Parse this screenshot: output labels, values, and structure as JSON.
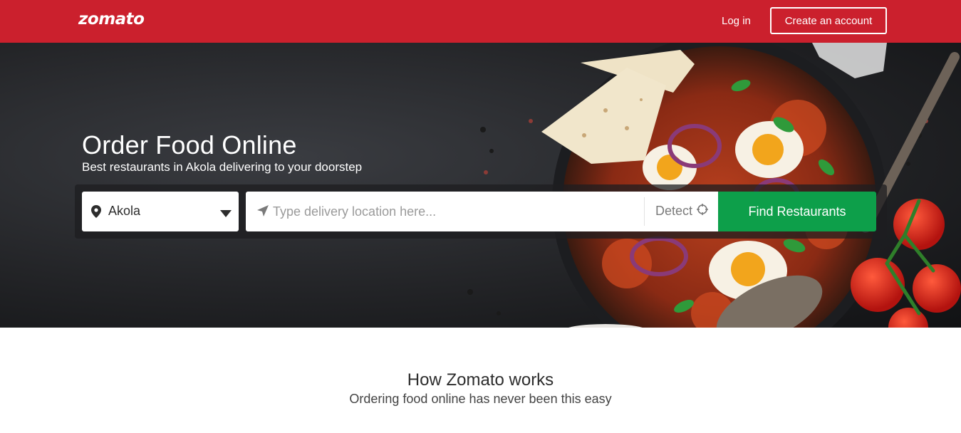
{
  "header": {
    "logo": "zomato",
    "login_label": "Log in",
    "create_account_label": "Create an account",
    "brand_color": "#cb202d"
  },
  "hero": {
    "title": "Order Food Online",
    "subtitle": "Best restaurants in Akola delivering to your doorstep",
    "city_select": {
      "value": "Akola",
      "icon": "location-pin-icon"
    },
    "location_input": {
      "placeholder": "Type delivery location here...",
      "value": "",
      "icon": "navigation-arrow-icon"
    },
    "detect_label": "Detect",
    "detect_icon": "crosshair-icon",
    "find_button_label": "Find Restaurants",
    "find_button_color": "#0d9f4a"
  },
  "how_it_works": {
    "title": "How Zomato works",
    "subtitle": "Ordering food online has never been this easy"
  }
}
